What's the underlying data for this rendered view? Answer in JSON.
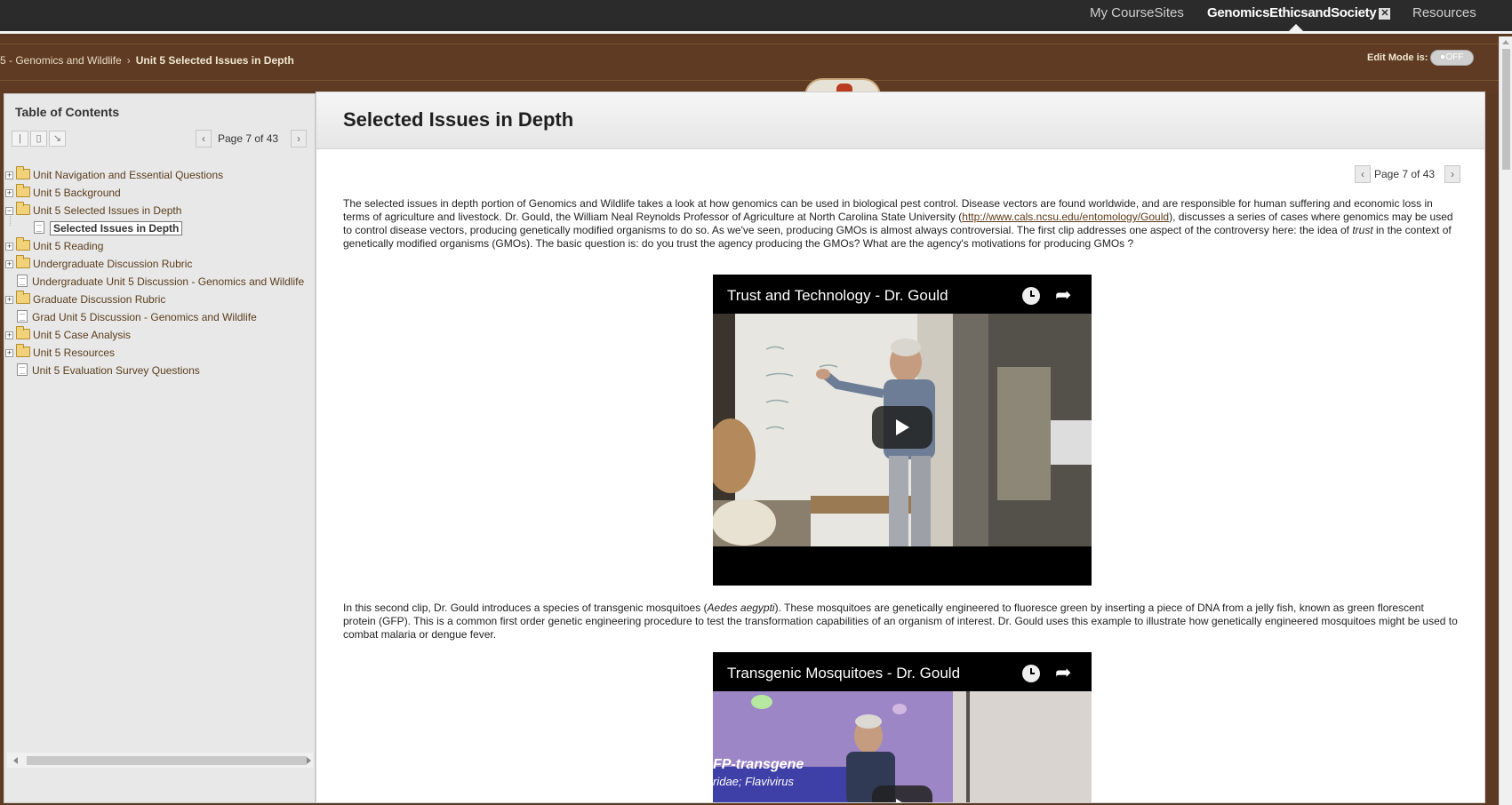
{
  "topnav": {
    "my_coursesites": "My CourseSites",
    "course_name": "GenomicsEthicsandSociety",
    "course_close": "✕",
    "resources": "Resources"
  },
  "breadcrumb": {
    "parent": "5 - Genomics and Wildlife",
    "separator": "›",
    "current": "Unit 5 Selected Issues in Depth"
  },
  "edit_mode": {
    "label": "Edit Mode is:",
    "state": "OFF"
  },
  "toc": {
    "title": "Table of Contents",
    "page_indicator": "Page 7 of 43",
    "items": [
      {
        "label": "Unit Navigation and Essential Questions",
        "type": "folder",
        "expander": "+"
      },
      {
        "label": "Unit 5 Background",
        "type": "folder",
        "expander": "+"
      },
      {
        "label": "Unit 5 Selected Issues in Depth",
        "type": "folder",
        "expander": "−"
      },
      {
        "label": "Selected Issues in Depth",
        "type": "page",
        "selected": true
      },
      {
        "label": "Unit 5 Reading",
        "type": "folder",
        "expander": "+"
      },
      {
        "label": "Undergraduate Discussion Rubric",
        "type": "folder",
        "expander": "+"
      },
      {
        "label": "Undergraduate Unit 5 Discussion - Genomics and Wildlife",
        "type": "page"
      },
      {
        "label": "Graduate Discussion Rubric",
        "type": "folder",
        "expander": "+"
      },
      {
        "label": "Grad Unit 5 Discussion - Genomics and Wildlife",
        "type": "page"
      },
      {
        "label": "Unit 5 Case Analysis",
        "type": "folder",
        "expander": "+"
      },
      {
        "label": "Unit 5 Resources",
        "type": "folder",
        "expander": "+"
      },
      {
        "label": "Unit 5 Evaluation Survey Questions",
        "type": "page"
      }
    ]
  },
  "content": {
    "title": "Selected Issues in Depth",
    "page_indicator": "Page 7 of 43",
    "para1_a": "The selected issues in depth portion of Genomics and Wildlife takes a look at how genomics can be used in biological pest control. Disease vectors are found worldwide, and are responsible for human suffering and economic loss in terms of agriculture  and livestock.  Dr. Gould, the William Neal Reynolds Professor of Agriculture at North Carolina State University (",
    "para1_link": "http://www.cals.ncsu.edu/entomology/Gould",
    "para1_b": "), discusses a series of cases where genomics may be used to control disease vectors, producing genetically modified organisms to do so. As we've seen, producing GMOs is almost always controversial. The first clip addresses one aspect of the controversy here: the idea of ",
    "para1_em": "trust",
    "para1_c": " in the context of genetically modified organisms (GMOs). The basic question is: do you trust the agency producing the GMOs? What are the agency's motivations for producing GMOs ?",
    "video1_title": "Trust and Technology - Dr. Gould",
    "para2_a": "In this second clip, Dr. Gould introduces a species of transgenic mosquitoes (",
    "para2_em": "Aedes aegypti",
    "para2_b": "). These mosquitoes are genetically engineered to fluoresce green by inserting a piece of DNA from a jelly fish, known as green florescent protein (GFP). This is a common first order genetic engineering procedure to test the transformation capabilities of an organism of interest. Dr. Gould uses this example to illustrate how genetically engineered mosquitoes might be used to combat malaria or dengue fever.",
    "video2_title": "Transgenic Mosquitoes - Dr. Gould",
    "video2_slide_line1": "FP-transgene",
    "video2_slide_line2": "ridae; Flavivirus"
  },
  "icons": {
    "prev": "‹",
    "next": "›",
    "share": "➦"
  }
}
